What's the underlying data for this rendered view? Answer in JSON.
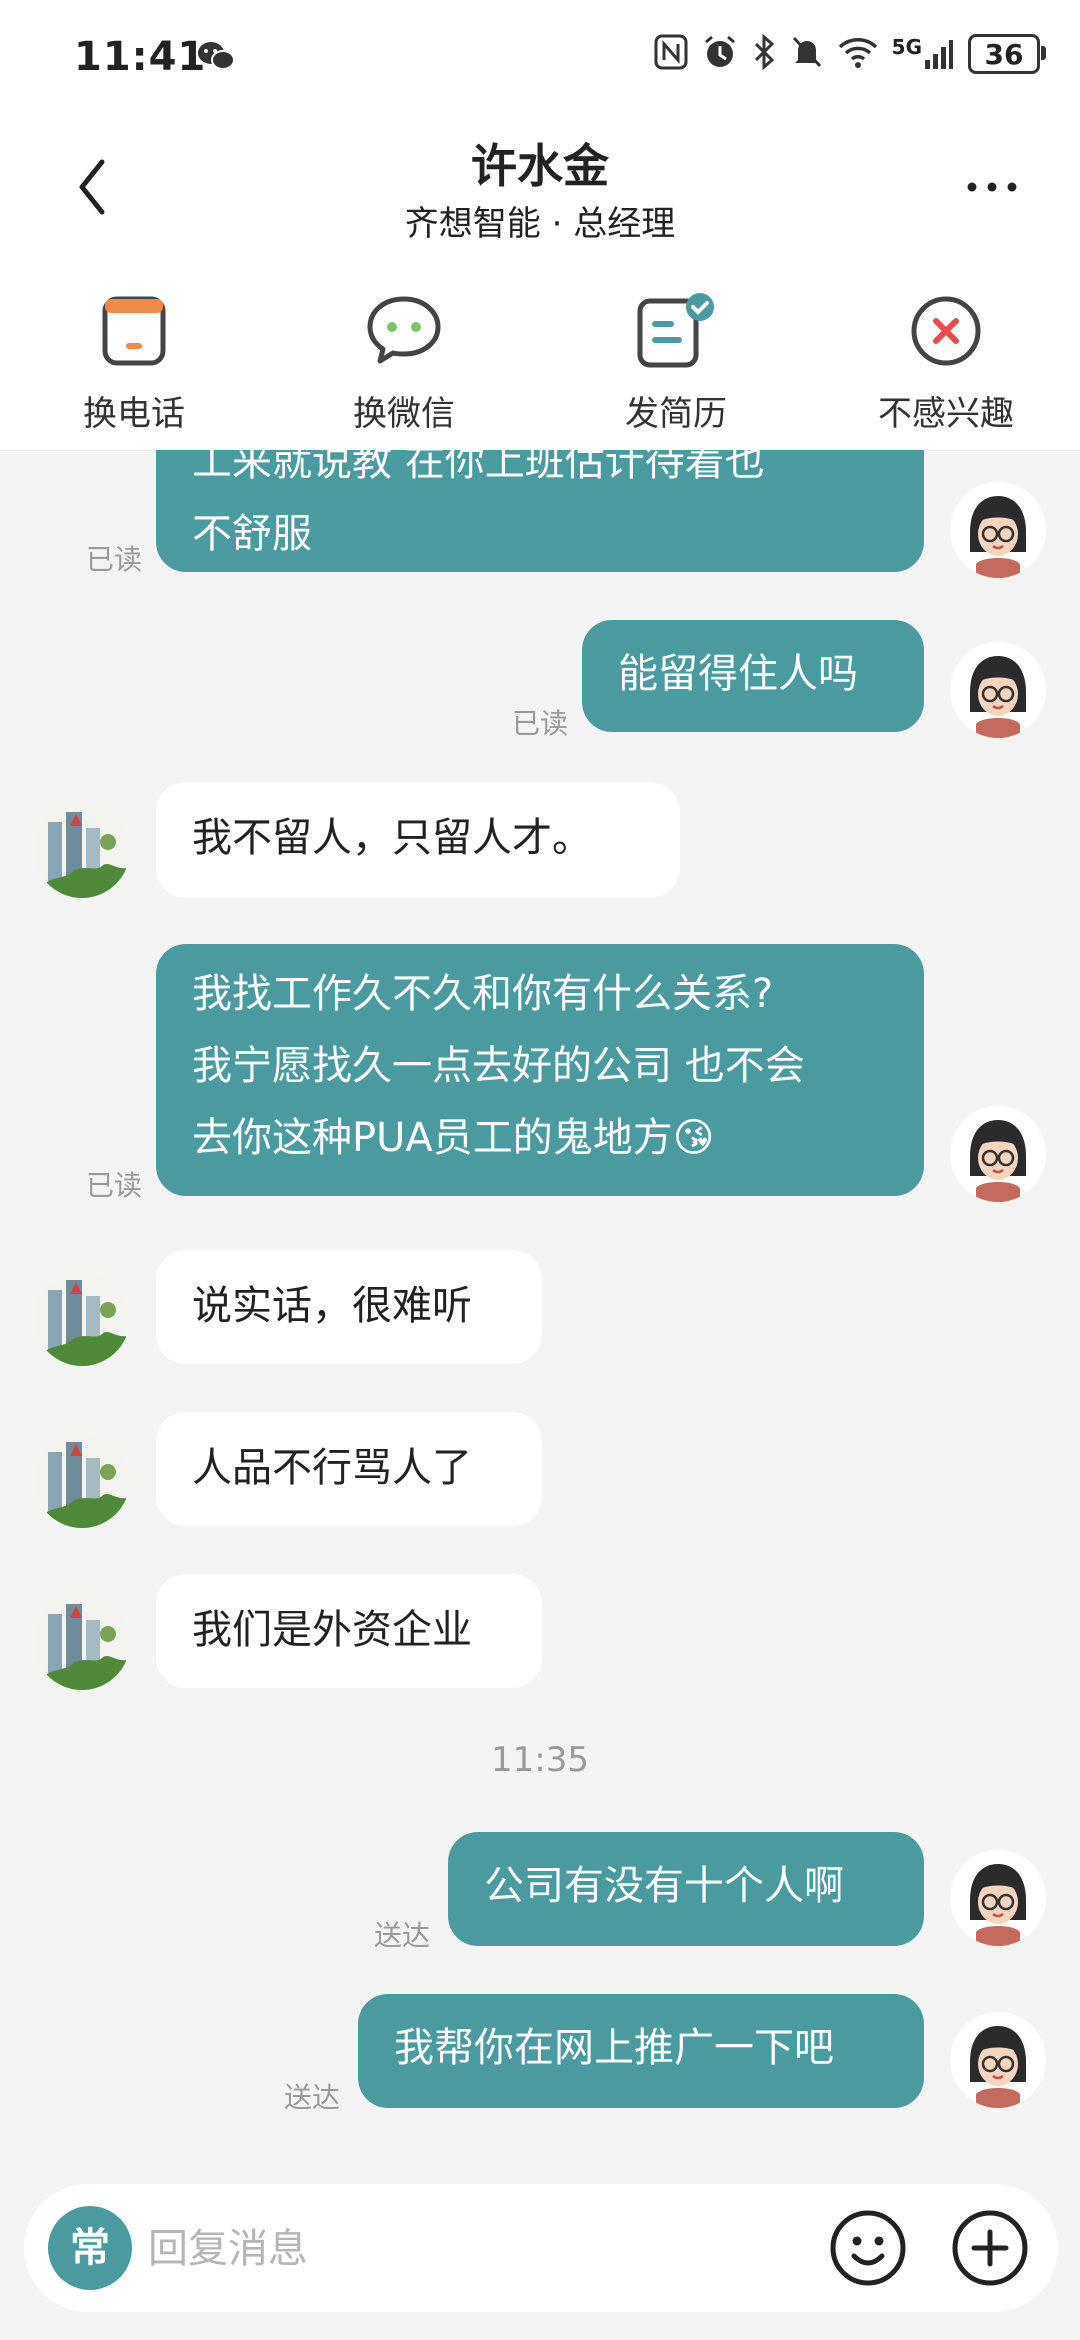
{
  "status_bar": {
    "time": "11:41",
    "battery": "36",
    "network": "5G"
  },
  "header": {
    "name": "许水金",
    "subtitle": "齐想智能 · 总经理"
  },
  "actions": [
    {
      "label": "换电话",
      "icon": "phone-card-icon"
    },
    {
      "label": "换微信",
      "icon": "wechat-icon"
    },
    {
      "label": "发简历",
      "icon": "resume-icon"
    },
    {
      "label": "不感兴趣",
      "icon": "not-interested-icon"
    }
  ],
  "messages": [
    {
      "from": "me",
      "text": "工来就说教 在你上班估计待着也",
      "status": ""
    },
    {
      "from": "me",
      "text": "不舒服",
      "status": "已读"
    },
    {
      "from": "me",
      "text": "能留得住人吗",
      "status": "已读"
    },
    {
      "from": "them",
      "text": "我不留人，只留人才。"
    },
    {
      "from": "me",
      "lines": [
        "我找工作久不久和你有什么关系?",
        "我宁愿找久一点去好的公司 也不会",
        "去你这种PUA员工的鬼地方"
      ],
      "emoji": "😘",
      "status": "已读"
    },
    {
      "from": "them",
      "text": "说实话，很难听"
    },
    {
      "from": "them",
      "text": "人品不行骂人了"
    },
    {
      "from": "them",
      "text": "我们是外资企业"
    },
    {
      "time": "11:35"
    },
    {
      "from": "me",
      "text": "公司有没有十个人啊",
      "status": "送达"
    },
    {
      "from": "me",
      "text": "我帮你在网上推广一下吧",
      "status": "送达"
    }
  ],
  "input": {
    "quick_label": "常",
    "placeholder": "回复消息"
  },
  "colors": {
    "accent": "#4a9aa0",
    "orange": "#f08a4b",
    "red": "#e84c4c"
  }
}
